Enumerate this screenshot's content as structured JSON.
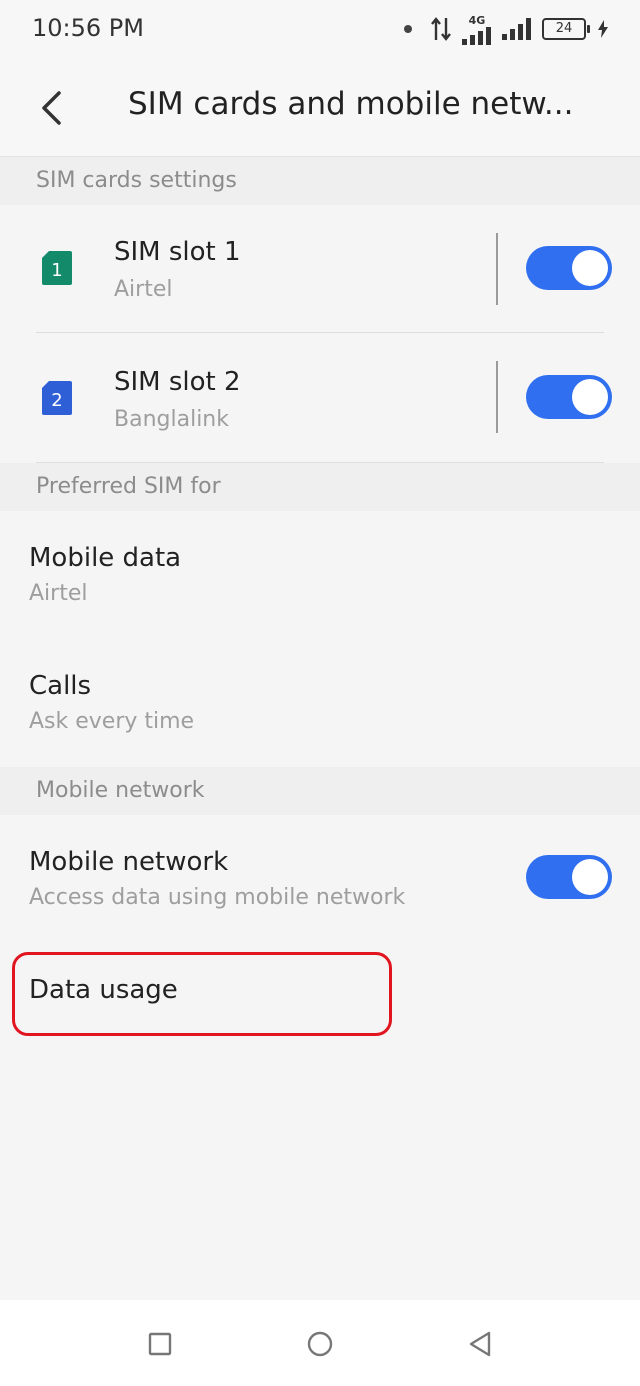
{
  "status_bar": {
    "time": "10:56 PM",
    "network_type": "4G",
    "battery_level": "24"
  },
  "header": {
    "title": "SIM cards and mobile netw..."
  },
  "sections": {
    "sim_settings": "SIM cards settings",
    "preferred_sim": "Preferred SIM for",
    "mobile_network": "Mobile network"
  },
  "sim_slots": [
    {
      "number": "1",
      "title": "SIM slot 1",
      "carrier": "Airtel",
      "enabled": true,
      "color": "#138a6a"
    },
    {
      "number": "2",
      "title": "SIM slot 2",
      "carrier": "Banglalink",
      "enabled": true,
      "color": "#2f5fd6"
    }
  ],
  "preferred": {
    "mobile_data": {
      "title": "Mobile data",
      "value": "Airtel"
    },
    "calls": {
      "title": "Calls",
      "value": "Ask every time"
    }
  },
  "mobile_network": {
    "title": "Mobile network",
    "description": "Access data using mobile network",
    "enabled": true
  },
  "data_usage": {
    "title": "Data usage"
  },
  "colors": {
    "accent": "#2f6ff0",
    "highlight": "#e0151f"
  }
}
